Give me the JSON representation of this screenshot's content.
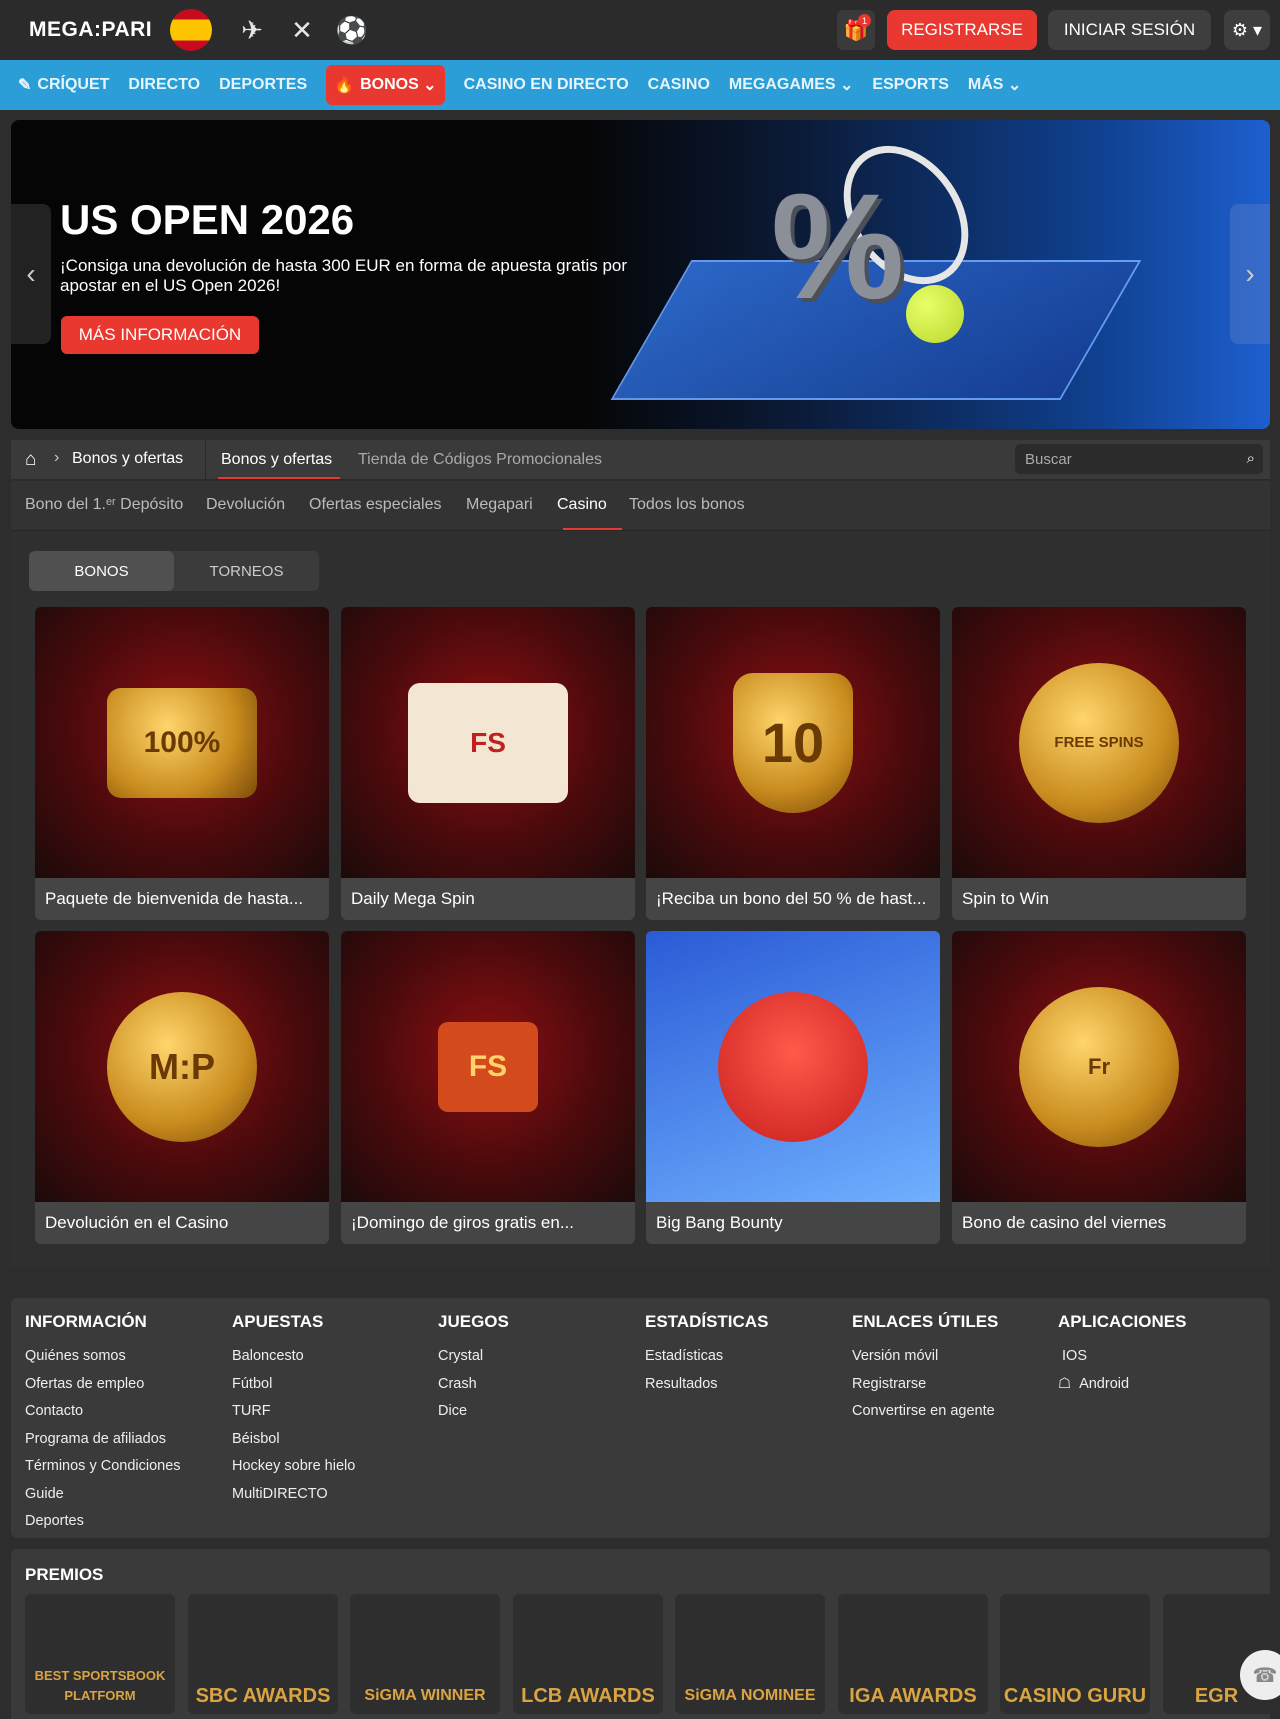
{
  "header": {
    "logo": "MEGA:PARI",
    "gift_badge": "1",
    "register_label": "REGISTRARSE",
    "login_label": "INICIAR SESIÓN"
  },
  "nav": {
    "items": [
      "CRÍQUET",
      "DIRECTO",
      "DEPORTES",
      "BONOS",
      "CASINO EN DIRECTO",
      "CASINO",
      "MEGAGAMES",
      "ESPORTS",
      "MÁS"
    ]
  },
  "hero": {
    "title": "US OPEN 2026",
    "text": "¡Consiga una devolución de hasta 300 EUR en forma de apuesta gratis por apostar en el US Open 2026!",
    "button": "MÁS INFORMACIÓN",
    "percent_symbol": "%"
  },
  "breadcrumb": {
    "current": "Bonos y ofertas",
    "tab_active": "Bonos y ofertas",
    "tab_other": "Tienda de Códigos Promocionales",
    "search_placeholder": "Buscar"
  },
  "subtabs": [
    "Bono del 1.ᵉʳ Depósito",
    "Devolución",
    "Ofertas especiales",
    "Megapari",
    "Casino",
    "Todos los bonos"
  ],
  "segment": {
    "bonos": "BONOS",
    "torneos": "TORNEOS"
  },
  "cards": [
    {
      "title": "Paquete de bienvenida de hasta...",
      "art": "100%"
    },
    {
      "title": "Daily Mega Spin",
      "art": "FS"
    },
    {
      "title": "¡Reciba un bono del 50 % de hast...",
      "art": "10"
    },
    {
      "title": "Spin to Win",
      "art": "FREE SPINS"
    },
    {
      "title": "Devolución en el Casino",
      "art": "M:P"
    },
    {
      "title": "¡Domingo de giros gratis en...",
      "art": "FS"
    },
    {
      "title": "Big Bang Bounty",
      "art": ""
    },
    {
      "title": "Bono de casino del viernes",
      "art": "Fr"
    }
  ],
  "footer": {
    "columns": [
      {
        "title": "INFORMACIÓN",
        "links": [
          "Quiénes somos",
          "Ofertas de empleo",
          "Contacto",
          "Programa de afiliados",
          "Términos y Condiciones",
          "Guide",
          "Deportes"
        ]
      },
      {
        "title": "APUESTAS",
        "links": [
          "Baloncesto",
          "Fútbol",
          "TURF",
          "Béisbol",
          "Hockey sobre hielo",
          "MultiDIRECTO"
        ]
      },
      {
        "title": "JUEGOS",
        "links": [
          "Crystal",
          "Crash",
          "Dice"
        ]
      },
      {
        "title": "ESTADÍSTICAS",
        "links": [
          "Estadísticas",
          "Resultados"
        ]
      },
      {
        "title": "ENLACES ÚTILES",
        "links": [
          "Versión móvil",
          "Registrarse",
          "Convertirse en agente"
        ]
      },
      {
        "title": "APLICACIONES",
        "links": [
          "IOS",
          "Android"
        ]
      }
    ]
  },
  "awards": {
    "title": "PREMIOS",
    "items": [
      "BEST SPORTSBOOK PLATFORM",
      "SBC AWARDS",
      "SiGMA WINNER",
      "LCB AWARDS",
      "SiGMA NOMINEE",
      "IGA AWARDS",
      "CASINO GURU",
      "EGR"
    ]
  }
}
